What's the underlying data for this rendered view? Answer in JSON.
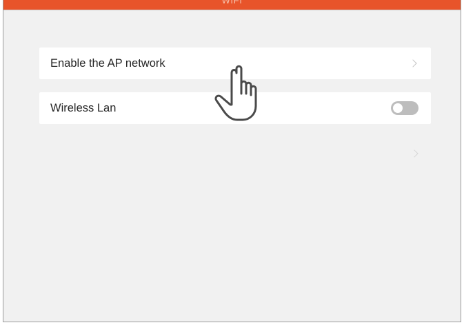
{
  "header": {
    "title": "WiFi",
    "accent_color": "#e8542a"
  },
  "settings": {
    "items": [
      {
        "label": "Enable the AP network",
        "control": "chevron-right-icon"
      },
      {
        "label": "Wireless Lan",
        "control": "toggle",
        "toggle_on": false
      }
    ],
    "extra_row_icon": "chevron-right-icon"
  },
  "overlay": {
    "pointer_icon": "hand-pointer-icon"
  }
}
